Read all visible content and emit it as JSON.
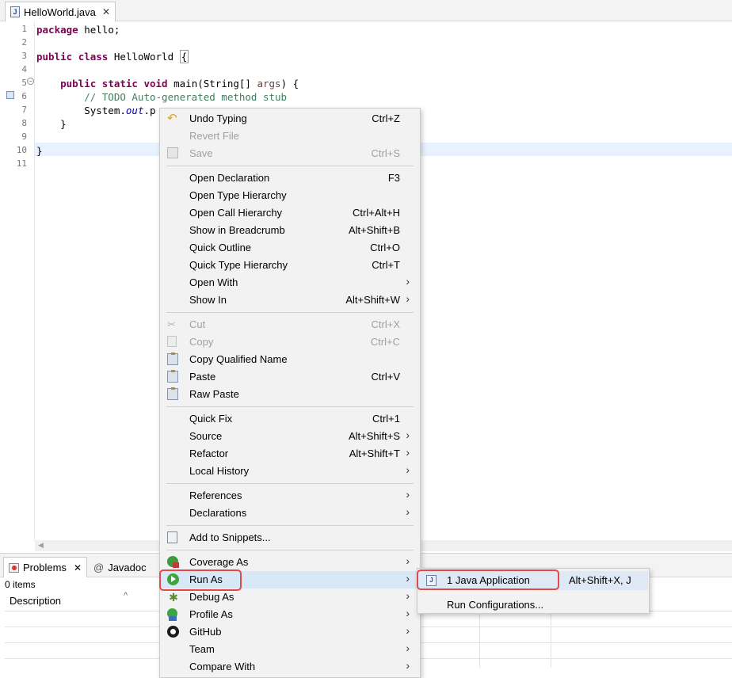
{
  "editor_tab": {
    "title": "HelloWorld.java",
    "close": "✕",
    "file_glyph": "J"
  },
  "code_lines": [
    {
      "n": "1",
      "segments": [
        {
          "t": "package",
          "c": "kw"
        },
        {
          "t": " hello;",
          "c": ""
        }
      ]
    },
    {
      "n": "2",
      "segments": []
    },
    {
      "n": "3",
      "segments": [
        {
          "t": "public",
          "c": "kw"
        },
        {
          "t": " ",
          "c": ""
        },
        {
          "t": "class",
          "c": "kw"
        },
        {
          "t": " HelloWorld ",
          "c": ""
        },
        {
          "t": "{",
          "c": "brace"
        }
      ]
    },
    {
      "n": "4",
      "segments": []
    },
    {
      "n": "5",
      "segments": [
        {
          "t": "    ",
          "c": ""
        },
        {
          "t": "public",
          "c": "kw"
        },
        {
          "t": " ",
          "c": ""
        },
        {
          "t": "static",
          "c": "kw"
        },
        {
          "t": " ",
          "c": ""
        },
        {
          "t": "void",
          "c": "kw"
        },
        {
          "t": " main(String[] ",
          "c": ""
        },
        {
          "t": "args",
          "c": "param"
        },
        {
          "t": ") {",
          "c": ""
        }
      ]
    },
    {
      "n": "6",
      "segments": [
        {
          "t": "        // TODO Auto-generated method stub",
          "c": "cm"
        }
      ]
    },
    {
      "n": "7",
      "segments": [
        {
          "t": "        System.",
          "c": ""
        },
        {
          "t": "out",
          "c": "fld"
        },
        {
          "t": ".p",
          "c": ""
        }
      ]
    },
    {
      "n": "8",
      "segments": [
        {
          "t": "    }",
          "c": ""
        }
      ]
    },
    {
      "n": "9",
      "segments": []
    },
    {
      "n": "10",
      "segments": [
        {
          "t": "}",
          "c": ""
        }
      ]
    },
    {
      "n": "11",
      "segments": []
    }
  ],
  "problems_view": {
    "tab_problems": "Problems",
    "tab_problems_close": "✕",
    "tab_javadoc": "Javadoc",
    "tab_javadoc_glyph": "@",
    "items_count": "0 items",
    "column_description": "Description",
    "sort_caret": "^"
  },
  "context_menu": {
    "items": [
      {
        "id": "undo-typing",
        "label": "Undo Typing",
        "accel": "Ctrl+Z",
        "icon": "undo-icon",
        "enabled": true
      },
      {
        "id": "revert-file",
        "label": "Revert File",
        "accel": "",
        "icon": "",
        "enabled": false
      },
      {
        "id": "save",
        "label": "Save",
        "accel": "Ctrl+S",
        "icon": "save-icon",
        "enabled": false
      },
      {
        "sep": true
      },
      {
        "id": "open-declaration",
        "label": "Open Declaration",
        "accel": "F3",
        "enabled": true
      },
      {
        "id": "open-type-hierarchy",
        "label": "Open Type Hierarchy",
        "accel": "",
        "enabled": true
      },
      {
        "id": "open-call-hierarchy",
        "label": "Open Call Hierarchy",
        "accel": "Ctrl+Alt+H",
        "enabled": true
      },
      {
        "id": "show-in-breadcrumb",
        "label": "Show in Breadcrumb",
        "accel": "Alt+Shift+B",
        "enabled": true
      },
      {
        "id": "quick-outline",
        "label": "Quick Outline",
        "accel": "Ctrl+O",
        "enabled": true
      },
      {
        "id": "quick-type-hierarchy",
        "label": "Quick Type Hierarchy",
        "accel": "Ctrl+T",
        "enabled": true
      },
      {
        "id": "open-with",
        "label": "Open With",
        "accel": "",
        "submenu": true,
        "enabled": true
      },
      {
        "id": "show-in",
        "label": "Show In",
        "accel": "Alt+Shift+W",
        "submenu": true,
        "enabled": true
      },
      {
        "sep": true
      },
      {
        "id": "cut",
        "label": "Cut",
        "accel": "Ctrl+X",
        "icon": "scissors-icon",
        "enabled": false
      },
      {
        "id": "copy",
        "label": "Copy",
        "accel": "Ctrl+C",
        "icon": "copy-icon",
        "enabled": false
      },
      {
        "id": "copy-qualified-name",
        "label": "Copy Qualified Name",
        "accel": "",
        "icon": "paste-icon",
        "enabled": true
      },
      {
        "id": "paste",
        "label": "Paste",
        "accel": "Ctrl+V",
        "icon": "paste-icon",
        "enabled": true
      },
      {
        "id": "raw-paste",
        "label": "Raw Paste",
        "accel": "",
        "icon": "paste-icon",
        "enabled": true
      },
      {
        "sep": true
      },
      {
        "id": "quick-fix",
        "label": "Quick Fix",
        "accel": "Ctrl+1",
        "enabled": true
      },
      {
        "id": "source",
        "label": "Source",
        "accel": "Alt+Shift+S",
        "submenu": true,
        "enabled": true
      },
      {
        "id": "refactor",
        "label": "Refactor",
        "accel": "Alt+Shift+T",
        "submenu": true,
        "enabled": true
      },
      {
        "id": "local-history",
        "label": "Local History",
        "accel": "",
        "submenu": true,
        "enabled": true
      },
      {
        "sep": true
      },
      {
        "id": "references",
        "label": "References",
        "accel": "",
        "submenu": true,
        "enabled": true
      },
      {
        "id": "declarations",
        "label": "Declarations",
        "accel": "",
        "submenu": true,
        "enabled": true
      },
      {
        "sep": true
      },
      {
        "id": "add-to-snippets",
        "label": "Add to Snippets...",
        "accel": "",
        "icon": "snippet-icon",
        "enabled": true
      },
      {
        "sep": true
      },
      {
        "id": "coverage-as",
        "label": "Coverage As",
        "accel": "",
        "icon": "coverage-icon",
        "submenu": true,
        "enabled": true
      },
      {
        "id": "run-as",
        "label": "Run As",
        "accel": "",
        "icon": "run-icon",
        "submenu": true,
        "enabled": true,
        "hover": true
      },
      {
        "id": "debug-as",
        "label": "Debug As",
        "accel": "",
        "icon": "debug-icon",
        "submenu": true,
        "enabled": true
      },
      {
        "id": "profile-as",
        "label": "Profile As",
        "accel": "",
        "icon": "profile-icon",
        "submenu": true,
        "enabled": true
      },
      {
        "id": "github",
        "label": "GitHub",
        "accel": "",
        "icon": "github-icon",
        "submenu": true,
        "enabled": true
      },
      {
        "id": "team",
        "label": "Team",
        "accel": "",
        "submenu": true,
        "enabled": true
      },
      {
        "id": "compare-with",
        "label": "Compare With",
        "accel": "",
        "submenu": true,
        "enabled": true
      }
    ],
    "submenu_arrow": "›"
  },
  "run_as_submenu": {
    "items": [
      {
        "id": "java-application",
        "label": "1 Java Application",
        "accel": "Alt+Shift+X, J",
        "icon": "java-app-icon",
        "hover": true
      },
      {
        "id": "run-configurations",
        "label": "Run Configurations...",
        "accel": ""
      }
    ]
  },
  "colors": {
    "highlight": "#e24a4a",
    "menu_bg": "#f2f2f2",
    "hover_bg": "#d9e8f7",
    "keyword": "#7f0055",
    "comment": "#3f7f5f"
  }
}
